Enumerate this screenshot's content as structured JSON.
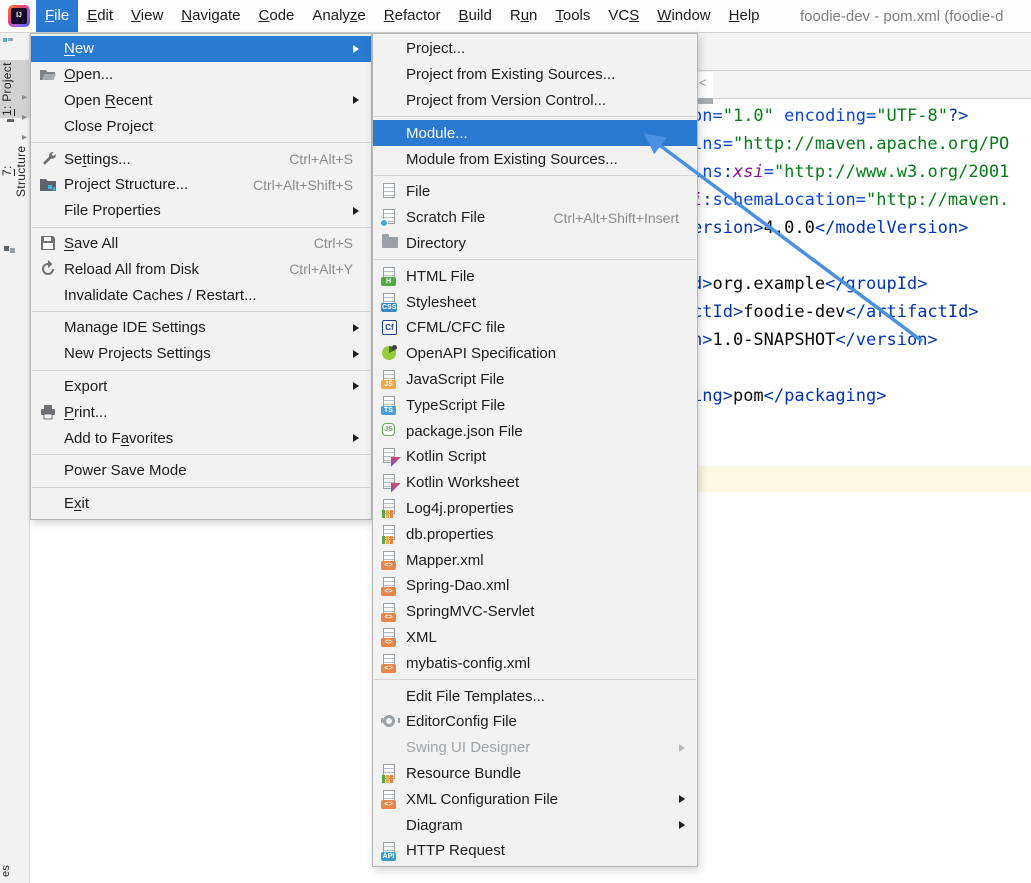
{
  "palette": {
    "selection": "#2a79d2",
    "menu_bg": "#f2f2f2",
    "menu_border": "#b6b6b6",
    "separator": "#d6d6d6",
    "shortcut_gray": "#8c8c8c",
    "title_gray": "#7f7f7f",
    "stripe_bg": "#f2f2f2",
    "stripe_selected": "#d2d2d2",
    "editor_bg": "#ffffff",
    "band_bg": "#f3f3f3",
    "band_border": "#d2d2d2",
    "line_highlight": "#fbf8e3",
    "arrow_blue": "#4a90e2",
    "code_attr": "#0b45da",
    "code_ns": "#871094",
    "code_str": "#067d17",
    "code_tag": "#0033b3",
    "code_text": "#080808"
  },
  "window": {
    "title": "foodie-dev - pom.xml (foodie-d"
  },
  "menubar": {
    "items": [
      {
        "label": "File",
        "mnemonic": "F",
        "selected": true
      },
      {
        "label": "Edit",
        "mnemonic": "E"
      },
      {
        "label": "View",
        "mnemonic": "V"
      },
      {
        "label": "Navigate",
        "mnemonic": "N"
      },
      {
        "label": "Code",
        "mnemonic": "C"
      },
      {
        "label": "Analyze",
        "mnemonic": "z"
      },
      {
        "label": "Refactor",
        "mnemonic": "R"
      },
      {
        "label": "Build",
        "mnemonic": "B"
      },
      {
        "label": "Run",
        "mnemonic": "u"
      },
      {
        "label": "Tools",
        "mnemonic": "T"
      },
      {
        "label": "VCS",
        "mnemonic": "S"
      },
      {
        "label": "Window",
        "mnemonic": "W"
      },
      {
        "label": "Help",
        "mnemonic": "H"
      }
    ]
  },
  "file_menu": {
    "items": [
      {
        "label": "New",
        "mnemonic": "N",
        "submenu": true,
        "selected": true
      },
      {
        "label": "Open...",
        "mnemonic": "O",
        "icon": "folder-open"
      },
      {
        "label": "Open Recent",
        "mnemonic": "R",
        "submenu": true
      },
      {
        "label": "Close Project",
        "mnemonic": "j"
      },
      {
        "sep": true
      },
      {
        "label": "Settings...",
        "mnemonic": "t",
        "icon": "wrench",
        "shortcut": "Ctrl+Alt+S"
      },
      {
        "label": "Project Structure...",
        "icon": "project-structure",
        "shortcut": "Ctrl+Alt+Shift+S"
      },
      {
        "label": "File Properties",
        "submenu": true
      },
      {
        "sep": true
      },
      {
        "label": "Save All",
        "mnemonic": "S",
        "icon": "save",
        "shortcut": "Ctrl+S"
      },
      {
        "label": "Reload All from Disk",
        "icon": "reload",
        "shortcut": "Ctrl+Alt+Y"
      },
      {
        "label": "Invalidate Caches / Restart..."
      },
      {
        "sep": true
      },
      {
        "label": "Manage IDE Settings",
        "submenu": true
      },
      {
        "label": "New Projects Settings",
        "submenu": true
      },
      {
        "sep": true
      },
      {
        "label": "Export",
        "submenu": true
      },
      {
        "label": "Print...",
        "mnemonic": "P",
        "icon": "printer"
      },
      {
        "label": "Add to Favorites",
        "mnemonic": "a",
        "submenu": true
      },
      {
        "sep": true
      },
      {
        "label": "Power Save Mode"
      },
      {
        "sep": true
      },
      {
        "label": "Exit",
        "mnemonic": "x"
      }
    ]
  },
  "new_submenu": {
    "items": [
      {
        "label": "Project..."
      },
      {
        "label": "Project from Existing Sources..."
      },
      {
        "label": "Project from Version Control..."
      },
      {
        "sep": true
      },
      {
        "label": "Module...",
        "selected": true
      },
      {
        "label": "Module from Existing Sources..."
      },
      {
        "sep": true
      },
      {
        "label": "File",
        "icon": "file"
      },
      {
        "label": "Scratch File",
        "icon": "scratch",
        "shortcut": "Ctrl+Alt+Shift+Insert"
      },
      {
        "label": "Directory",
        "icon": "dir"
      },
      {
        "sep": true
      },
      {
        "label": "HTML File",
        "icon": "html",
        "badge": "H"
      },
      {
        "label": "Stylesheet",
        "icon": "css",
        "badge": "CSS"
      },
      {
        "label": "CFML/CFC file",
        "icon": "cf",
        "badge": "Cf"
      },
      {
        "label": "OpenAPI Specification",
        "icon": "openapi"
      },
      {
        "label": "JavaScript File",
        "icon": "js",
        "badge": "JS"
      },
      {
        "label": "TypeScript File",
        "icon": "ts",
        "badge": "TS"
      },
      {
        "label": "package.json File",
        "icon": "node",
        "badge": "JS"
      },
      {
        "label": "Kotlin Script",
        "icon": "kotlin"
      },
      {
        "label": "Kotlin Worksheet",
        "icon": "kotlin"
      },
      {
        "label": "Log4j.properties",
        "icon": "props"
      },
      {
        "label": "db.properties",
        "icon": "props"
      },
      {
        "label": "Mapper.xml",
        "icon": "xml",
        "badge": "<>"
      },
      {
        "label": "Spring-Dao.xml",
        "icon": "xml",
        "badge": "<>"
      },
      {
        "label": "SpringMVC-Servlet",
        "icon": "xml",
        "badge": "<>"
      },
      {
        "label": "XML",
        "icon": "xml",
        "badge": "<>"
      },
      {
        "label": "mybatis-config.xml",
        "icon": "xml",
        "badge": "<>"
      },
      {
        "sep": true
      },
      {
        "label": "Edit File Templates..."
      },
      {
        "label": "EditorConfig File",
        "icon": "gear"
      },
      {
        "label": "Swing UI Designer",
        "disabled": true,
        "submenu": true
      },
      {
        "label": "Resource Bundle",
        "icon": "props"
      },
      {
        "label": "XML Configuration File",
        "icon": "xml",
        "badge": "<>",
        "submenu": true
      },
      {
        "label": "Diagram",
        "submenu": true
      },
      {
        "label": "HTTP Request",
        "icon": "api",
        "badge": "API"
      }
    ]
  },
  "left_stripe": {
    "labels": [
      {
        "label": "1: Project",
        "mnemonic": "1",
        "selected": true
      },
      {
        "label": "7: Structure",
        "mnemonic": "7"
      }
    ],
    "bottom_label": "es"
  },
  "editor": {
    "lines": [
      [
        [
          "on=",
          "attr"
        ],
        [
          "\"1.0\"",
          "str"
        ],
        [
          " ",
          "text"
        ],
        [
          "encoding=",
          "attr"
        ],
        [
          "\"UTF-8\"",
          "str"
        ],
        [
          "?>",
          "tag"
        ]
      ],
      [
        [
          "lns=",
          "attr"
        ],
        [
          "\"http://maven.apache.org/PO",
          "str"
        ]
      ],
      [
        [
          "lns",
          "attr"
        ],
        [
          ":",
          "tag"
        ],
        [
          "xsi",
          "ns"
        ],
        [
          "=",
          "attr"
        ],
        [
          "\"http://www.w3.org/2001",
          "str"
        ]
      ],
      [
        [
          "i",
          "ns"
        ],
        [
          ":",
          "tag"
        ],
        [
          "schemaLocation=",
          "attr"
        ],
        [
          "\"http://maven.",
          "str"
        ]
      ],
      [
        [
          "ersion>",
          "tag"
        ],
        [
          "4.0.0",
          "text"
        ],
        [
          "</modelVersion>",
          "tag"
        ]
      ],
      [],
      [
        [
          "d>",
          "tag"
        ],
        [
          "org.example",
          "text"
        ],
        [
          "</groupId>",
          "tag"
        ]
      ],
      [
        [
          "ctId>",
          "tag"
        ],
        [
          "foodie-dev",
          "text"
        ],
        [
          "</artifactId>",
          "tag"
        ]
      ],
      [
        [
          "n>",
          "tag"
        ],
        [
          "1.0-SNAPSHOT",
          "text"
        ],
        [
          "</version>",
          "tag"
        ]
      ],
      [],
      [
        [
          "ing>",
          "tag"
        ],
        [
          "pom",
          "text"
        ],
        [
          "</packaging>",
          "tag"
        ]
      ]
    ]
  }
}
